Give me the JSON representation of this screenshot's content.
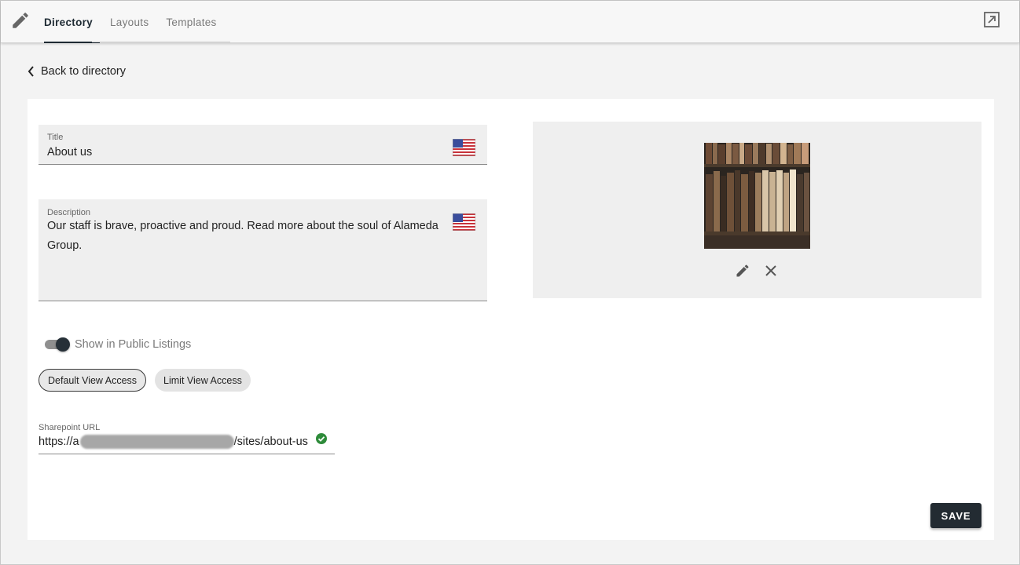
{
  "nav": {
    "app_icon": "pencil-icon",
    "tabs": [
      {
        "label": "Directory",
        "active": true
      },
      {
        "label": "Layouts",
        "active": false
      },
      {
        "label": "Templates",
        "active": false
      }
    ],
    "open_external_icon": "open-in-new-icon"
  },
  "back_link": {
    "label": "Back to directory",
    "icon": "chevron-left-icon"
  },
  "form": {
    "title": {
      "label": "Title",
      "value": "About us",
      "language_icon": "us-flag-icon"
    },
    "description": {
      "label": "Description",
      "value": "Our staff is brave, proactive and proud. Read more about the soul of Alameda Group.",
      "language_icon": "us-flag-icon"
    },
    "public_listing": {
      "label": "Show in Public Listings",
      "enabled": true
    },
    "access_chips": [
      {
        "label": "Default View Access",
        "selected": true
      },
      {
        "label": "Limit View Access",
        "selected": false
      }
    ],
    "sharepoint": {
      "label": "Sharepoint URL",
      "prefix": "https://a",
      "suffix": "/sites/about-us",
      "status_icon": "check-circle-icon",
      "status_color": "#2e8b3a"
    }
  },
  "image": {
    "thumbnail": "bookshelf-image",
    "edit_icon": "pencil-icon",
    "remove_icon": "close-icon"
  },
  "actions": {
    "save_label": "SAVE"
  },
  "colors": {
    "accent": "#232b32",
    "background": "#f3f3f3",
    "field_bg": "#efefef"
  }
}
